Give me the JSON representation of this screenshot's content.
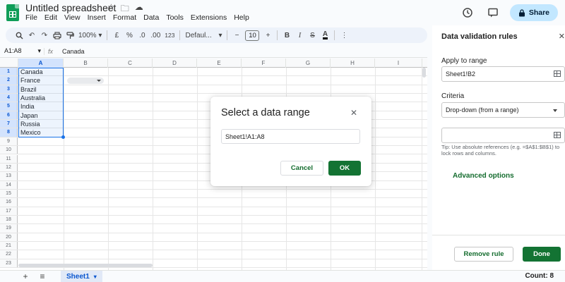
{
  "app": {
    "doc_title": "Untitled spreadsheet",
    "menu": [
      "File",
      "Edit",
      "View",
      "Insert",
      "Format",
      "Data",
      "Tools",
      "Extensions",
      "Help"
    ],
    "share_label": "Share"
  },
  "toolbar": {
    "zoom": "100%",
    "currency": "£",
    "percent": "%",
    "dec_decrease": ".0",
    "dec_increase": ".00",
    "number_format": "123",
    "font": "Defaul...",
    "font_size": "10",
    "bold": "B",
    "italic": "I",
    "minus": "−",
    "plus": "+"
  },
  "formula_bar": {
    "name_box": "A1:A8",
    "fx": "fx",
    "value": "Canada"
  },
  "sheet": {
    "columns": [
      "A",
      "B",
      "C",
      "D",
      "E",
      "F",
      "G",
      "H",
      "I"
    ],
    "rows": [
      "1",
      "2",
      "3",
      "4",
      "5",
      "6",
      "7",
      "8",
      "9",
      "10",
      "11",
      "12",
      "13",
      "14",
      "15",
      "16",
      "17",
      "18",
      "19",
      "20",
      "21",
      "22",
      "23"
    ],
    "col_a_values": [
      "Canada",
      "France",
      "Brazil",
      "Australia",
      "India",
      "Japan",
      "Russia",
      "Mexico"
    ],
    "tab_name": "Sheet1",
    "count_label": "Count: 8"
  },
  "panel": {
    "title": "Data validation rules",
    "apply_label": "Apply to range",
    "apply_value": "Sheet1!B2",
    "criteria_label": "Criteria",
    "criteria_value": "Drop-down (from a range)",
    "range_value": "",
    "tip": "Tip: Use absolute references (e.g. =$A$1:$B$1) to lock rows and columns.",
    "advanced_label": "Advanced options",
    "remove_label": "Remove rule",
    "done_label": "Done"
  },
  "dialog": {
    "title": "Select a data range",
    "input_value": "Sheet1!A1:A8",
    "cancel_label": "Cancel",
    "ok_label": "OK"
  },
  "colors": {
    "accent": "#1a73e8",
    "primary_green": "#137333",
    "share_bg": "#c2e7ff"
  }
}
